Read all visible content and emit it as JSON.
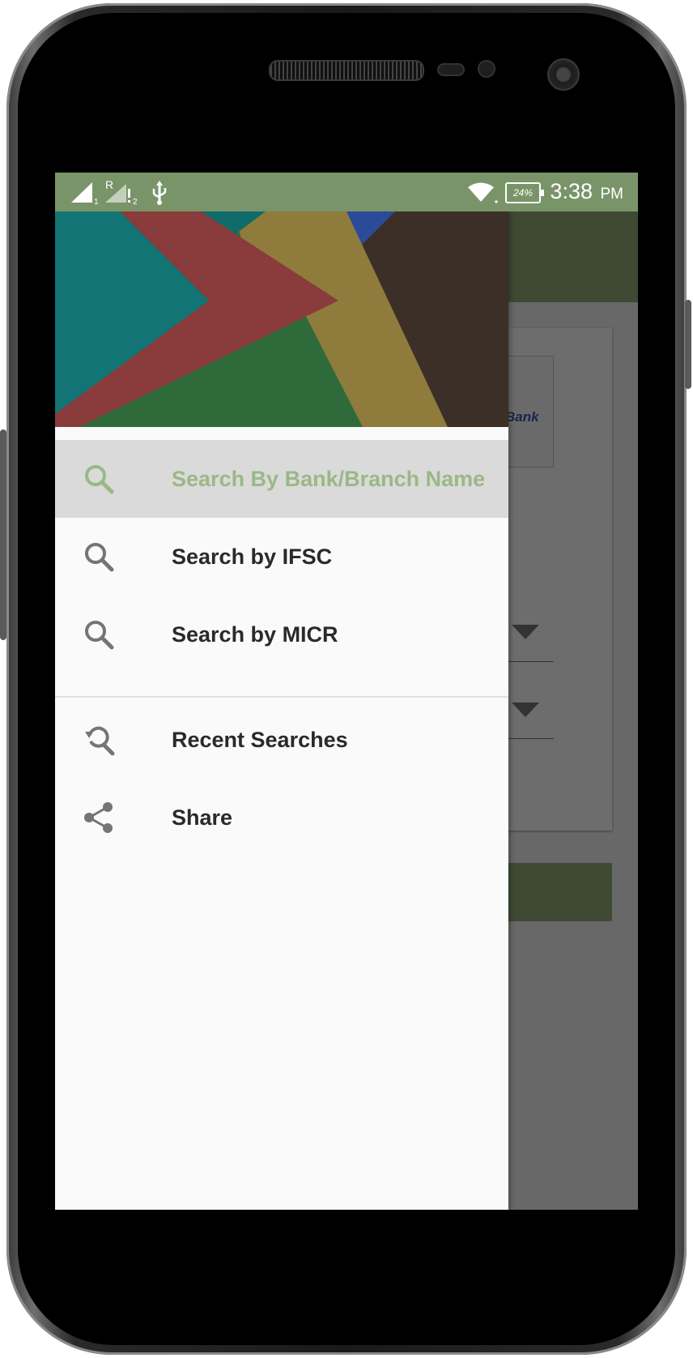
{
  "status_bar": {
    "time": "3:38",
    "ampm": "PM",
    "battery": "24%",
    "sim1": "1",
    "sim2": "2",
    "roaming": "R"
  },
  "background_app": {
    "logo_text": "Bank"
  },
  "drawer": {
    "items": [
      {
        "label": "Search By Bank/Branch Name",
        "icon": "search-icon",
        "active": true
      },
      {
        "label": "Search by IFSC",
        "icon": "search-icon",
        "active": false
      },
      {
        "label": "Search by MICR",
        "icon": "search-icon",
        "active": false
      },
      {
        "label": "Recent Searches",
        "icon": "recent-search-icon",
        "active": false
      },
      {
        "label": "Share",
        "icon": "share-icon",
        "active": false
      }
    ]
  },
  "colors": {
    "status_bar": "#7a9469",
    "accent": "#9ab886",
    "app_primary_dim": "#3e4a34",
    "drawer_bg": "#fafafa",
    "active_item_bg": "#dadada"
  }
}
